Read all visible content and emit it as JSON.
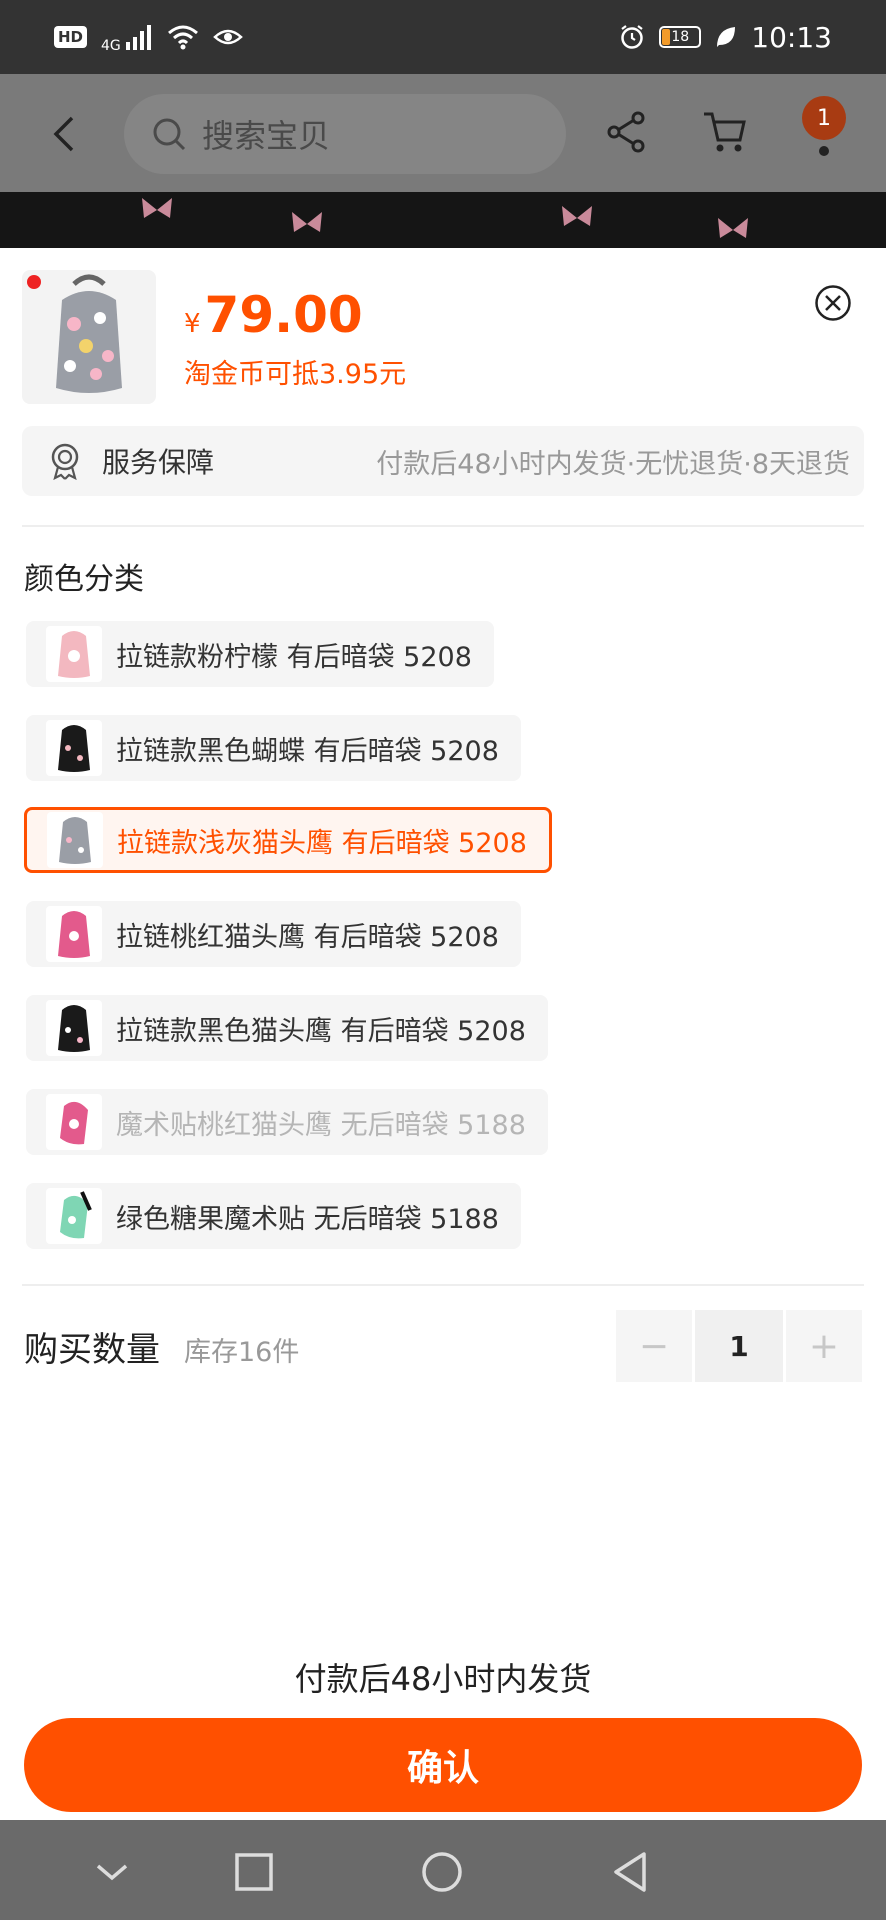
{
  "status_bar": {
    "hd": "HD",
    "network": "4G",
    "battery": "18",
    "time": "10:13"
  },
  "header": {
    "search_placeholder": "搜索宝贝",
    "cart_badge": "1"
  },
  "product": {
    "price_symbol": "¥",
    "price": "79.00",
    "coin_note": "淘金币可抵3.95元"
  },
  "service": {
    "label": "服务保障",
    "detail": "付款后48小时内发货·无忧退货·8天退货"
  },
  "color_section": {
    "title": "颜色分类",
    "options": [
      {
        "label": "拉链款粉柠檬 有后暗袋 5208",
        "state": "normal"
      },
      {
        "label": "拉链款黑色蝴蝶  有后暗袋 5208",
        "state": "normal"
      },
      {
        "label": "拉链款浅灰猫头鹰  有后暗袋 5208",
        "state": "selected"
      },
      {
        "label": "拉链桃红猫头鹰  有后暗袋 5208",
        "state": "normal"
      },
      {
        "label": "拉链款黑色猫头鹰  有后暗袋 5208",
        "state": "normal"
      },
      {
        "label": "魔术贴桃红猫头鹰 无后暗袋 5188",
        "state": "disabled"
      },
      {
        "label": "绿色糖果魔术贴  无后暗袋 5188",
        "state": "normal"
      }
    ]
  },
  "quantity": {
    "label": "购买数量",
    "stock": "库存16件",
    "minus": "−",
    "value": "1",
    "plus": "+"
  },
  "footer": {
    "shipping_note": "付款后48小时内发货",
    "confirm_label": "确认"
  },
  "colors": {
    "accent": "#ff5000",
    "selected_bg": "#fff5f0"
  }
}
